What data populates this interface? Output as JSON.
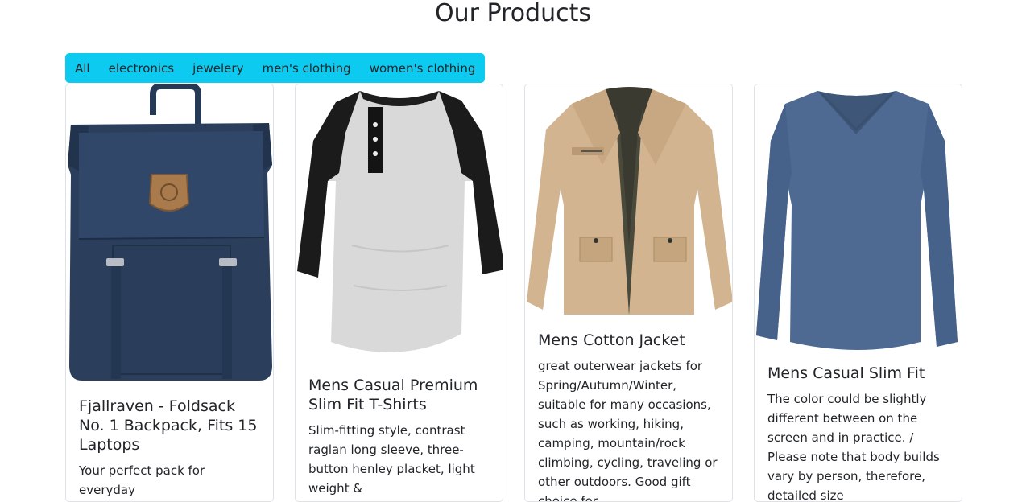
{
  "header": {
    "title": "Our Products"
  },
  "filters": [
    "All",
    "electronics",
    "jewelery",
    "men's clothing",
    "women's clothing"
  ],
  "products": [
    {
      "title": "Fjallraven - Foldsack No. 1 Backpack, Fits 15 Laptops",
      "description": "Your perfect pack for everyday",
      "image": "backpack"
    },
    {
      "title": "Mens Casual Premium Slim Fit T-Shirts",
      "description": "Slim-fitting style, contrast raglan long sleeve, three-button henley placket, light weight &",
      "image": "raglan-tshirt"
    },
    {
      "title": "Mens Cotton Jacket",
      "description": "great outerwear jackets for Spring/Autumn/Winter, suitable for many occasions, such as working, hiking, camping, mountain/rock climbing, cycling, traveling or other outdoors. Good gift choice for",
      "image": "cotton-jacket"
    },
    {
      "title": "Mens Casual Slim Fit",
      "description": "The color could be slightly different between on the screen and in practice. / Please note that body builds vary by person, therefore, detailed size",
      "image": "slim-fit-shirt"
    }
  ]
}
